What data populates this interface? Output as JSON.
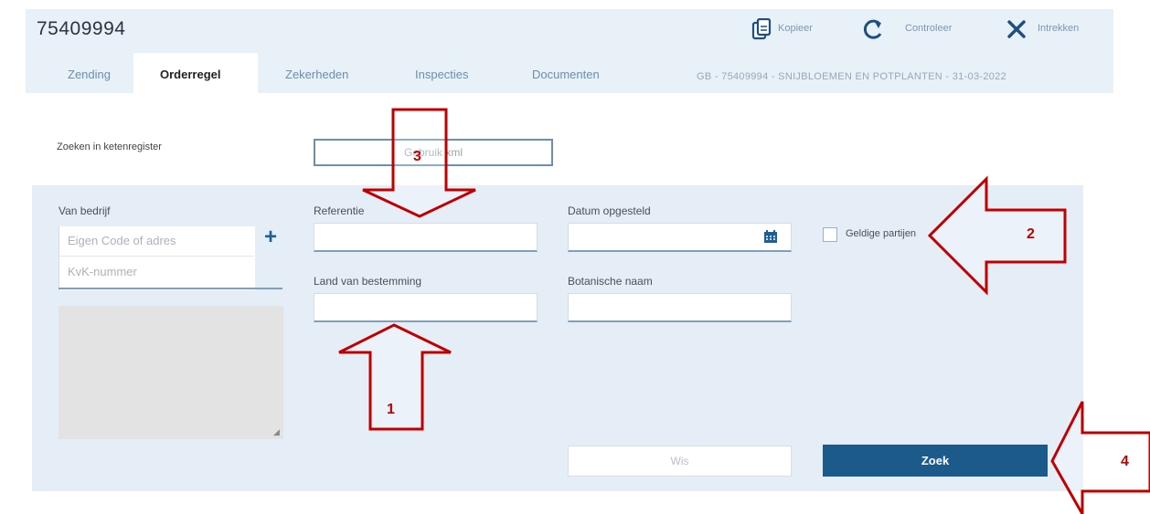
{
  "header": {
    "title": "75409994",
    "tabs": [
      {
        "label": "Zending"
      },
      {
        "label": "Orderregel"
      },
      {
        "label": "Zekerheden"
      },
      {
        "label": "Inspecties"
      },
      {
        "label": "Documenten"
      }
    ],
    "active_tab": "Orderregel",
    "summary": "GB - 75409994 - SNIJBLOEMEN EN POTPLANTEN - 31-03-2022",
    "actions": [
      {
        "label": "Kopieer",
        "icon": "copy-icon"
      },
      {
        "label": "Controleer",
        "icon": "refresh-icon"
      },
      {
        "label": "Intrekken",
        "icon": "close-icon"
      }
    ]
  },
  "search": {
    "label": "Zoeken in ketenregister",
    "xml_button": "Gebruik xml"
  },
  "form": {
    "company": {
      "label": "Van bedrijf",
      "placeholder_code": "Eigen Code of adres",
      "placeholder_kvk": "KvK-nummer"
    },
    "referentie": {
      "label": "Referentie",
      "value": ""
    },
    "datum": {
      "label": "Datum opgesteld",
      "value": ""
    },
    "geldige": {
      "label": "Geldige partijen",
      "checked": false
    },
    "land": {
      "label": "Land van bestemming",
      "value": ""
    },
    "botanisch": {
      "label": "Botanische naam",
      "value": ""
    },
    "buttons": {
      "wis": "Wis",
      "zoek": "Zoek"
    }
  },
  "annotations": {
    "arrow_1": "1",
    "arrow_2": "2",
    "arrow_3": "3",
    "arrow_4": "4"
  },
  "colors": {
    "accent": "#1c5a8c",
    "annotation_red": "#c00000",
    "panel_bg": "#e5eef7"
  }
}
